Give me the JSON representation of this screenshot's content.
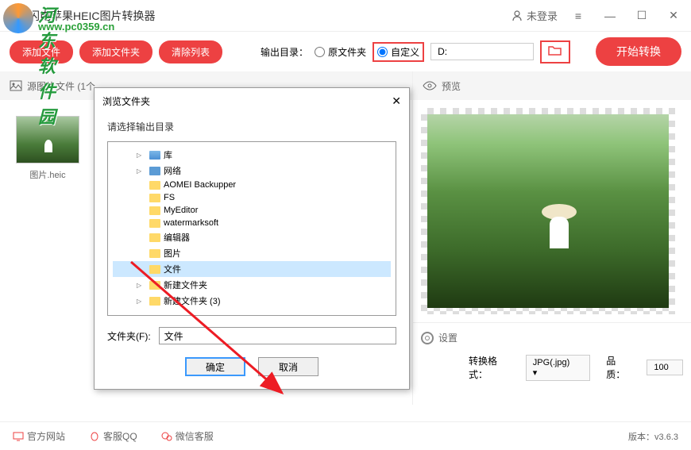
{
  "titlebar": {
    "app_title": "闪电苹果HEIC图片转换器",
    "login_label": "未登录"
  },
  "toolbar": {
    "add_file": "添加文件",
    "add_folder": "添加文件夹",
    "clear_list": "清除列表",
    "output_label": "输出目录：",
    "radio_original": "原文件夹",
    "radio_custom": "自定义",
    "output_path": "D:",
    "start_convert": "开始转换"
  },
  "left_panel": {
    "header": "源图片文件 (1个",
    "thumb_name": "图片.heic"
  },
  "right_panel": {
    "preview_label": "预览",
    "settings_label": "设置",
    "format_label": "转换格式：",
    "format_value": "JPG(.jpg)",
    "quality_label": "品质：",
    "quality_value": "100"
  },
  "footer": {
    "website": "官方网站",
    "qq": "客服QQ",
    "wechat": "微信客服",
    "version": "版本：v3.6.3"
  },
  "dialog": {
    "title": "浏览文件夹",
    "label": "请选择输出目录",
    "folder_label": "文件夹(F):",
    "folder_value": "文件",
    "ok": "确定",
    "cancel": "取消",
    "tree": [
      {
        "name": "库",
        "icon": "lib",
        "expand": true
      },
      {
        "name": "网络",
        "icon": "net",
        "expand": true
      },
      {
        "name": "AOMEI Backupper",
        "icon": "f"
      },
      {
        "name": "FS",
        "icon": "f"
      },
      {
        "name": "MyEditor",
        "icon": "f"
      },
      {
        "name": "watermarksoft",
        "icon": "f"
      },
      {
        "name": "编辑器",
        "icon": "f"
      },
      {
        "name": "图片",
        "icon": "f"
      },
      {
        "name": "文件",
        "icon": "f",
        "sel": true
      },
      {
        "name": "新建文件夹",
        "icon": "f",
        "expand": true
      },
      {
        "name": "新建文件夹 (3)",
        "icon": "f",
        "expand": true
      }
    ]
  },
  "watermark": {
    "text1": "河东软件园",
    "text2": "www.pc0359.cn"
  }
}
